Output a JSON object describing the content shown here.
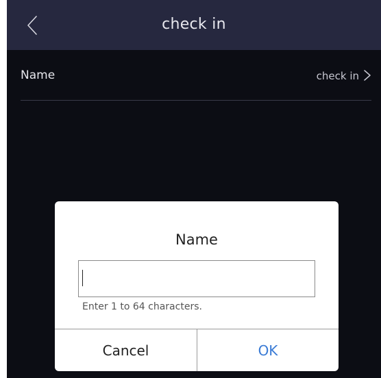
{
  "header": {
    "title": "check in",
    "back_icon": "chevron-left-icon"
  },
  "settings_row": {
    "label": "Name",
    "value": "check in",
    "chevron_icon": "chevron-right-icon"
  },
  "dialog": {
    "title": "Name",
    "input_value": "",
    "hint": "Enter 1 to 64 characters.",
    "cancel_label": "Cancel",
    "ok_label": "OK"
  },
  "colors": {
    "header_bg": "#26283f",
    "screen_bg": "#0c0d14",
    "accent": "#3a7bd5"
  }
}
